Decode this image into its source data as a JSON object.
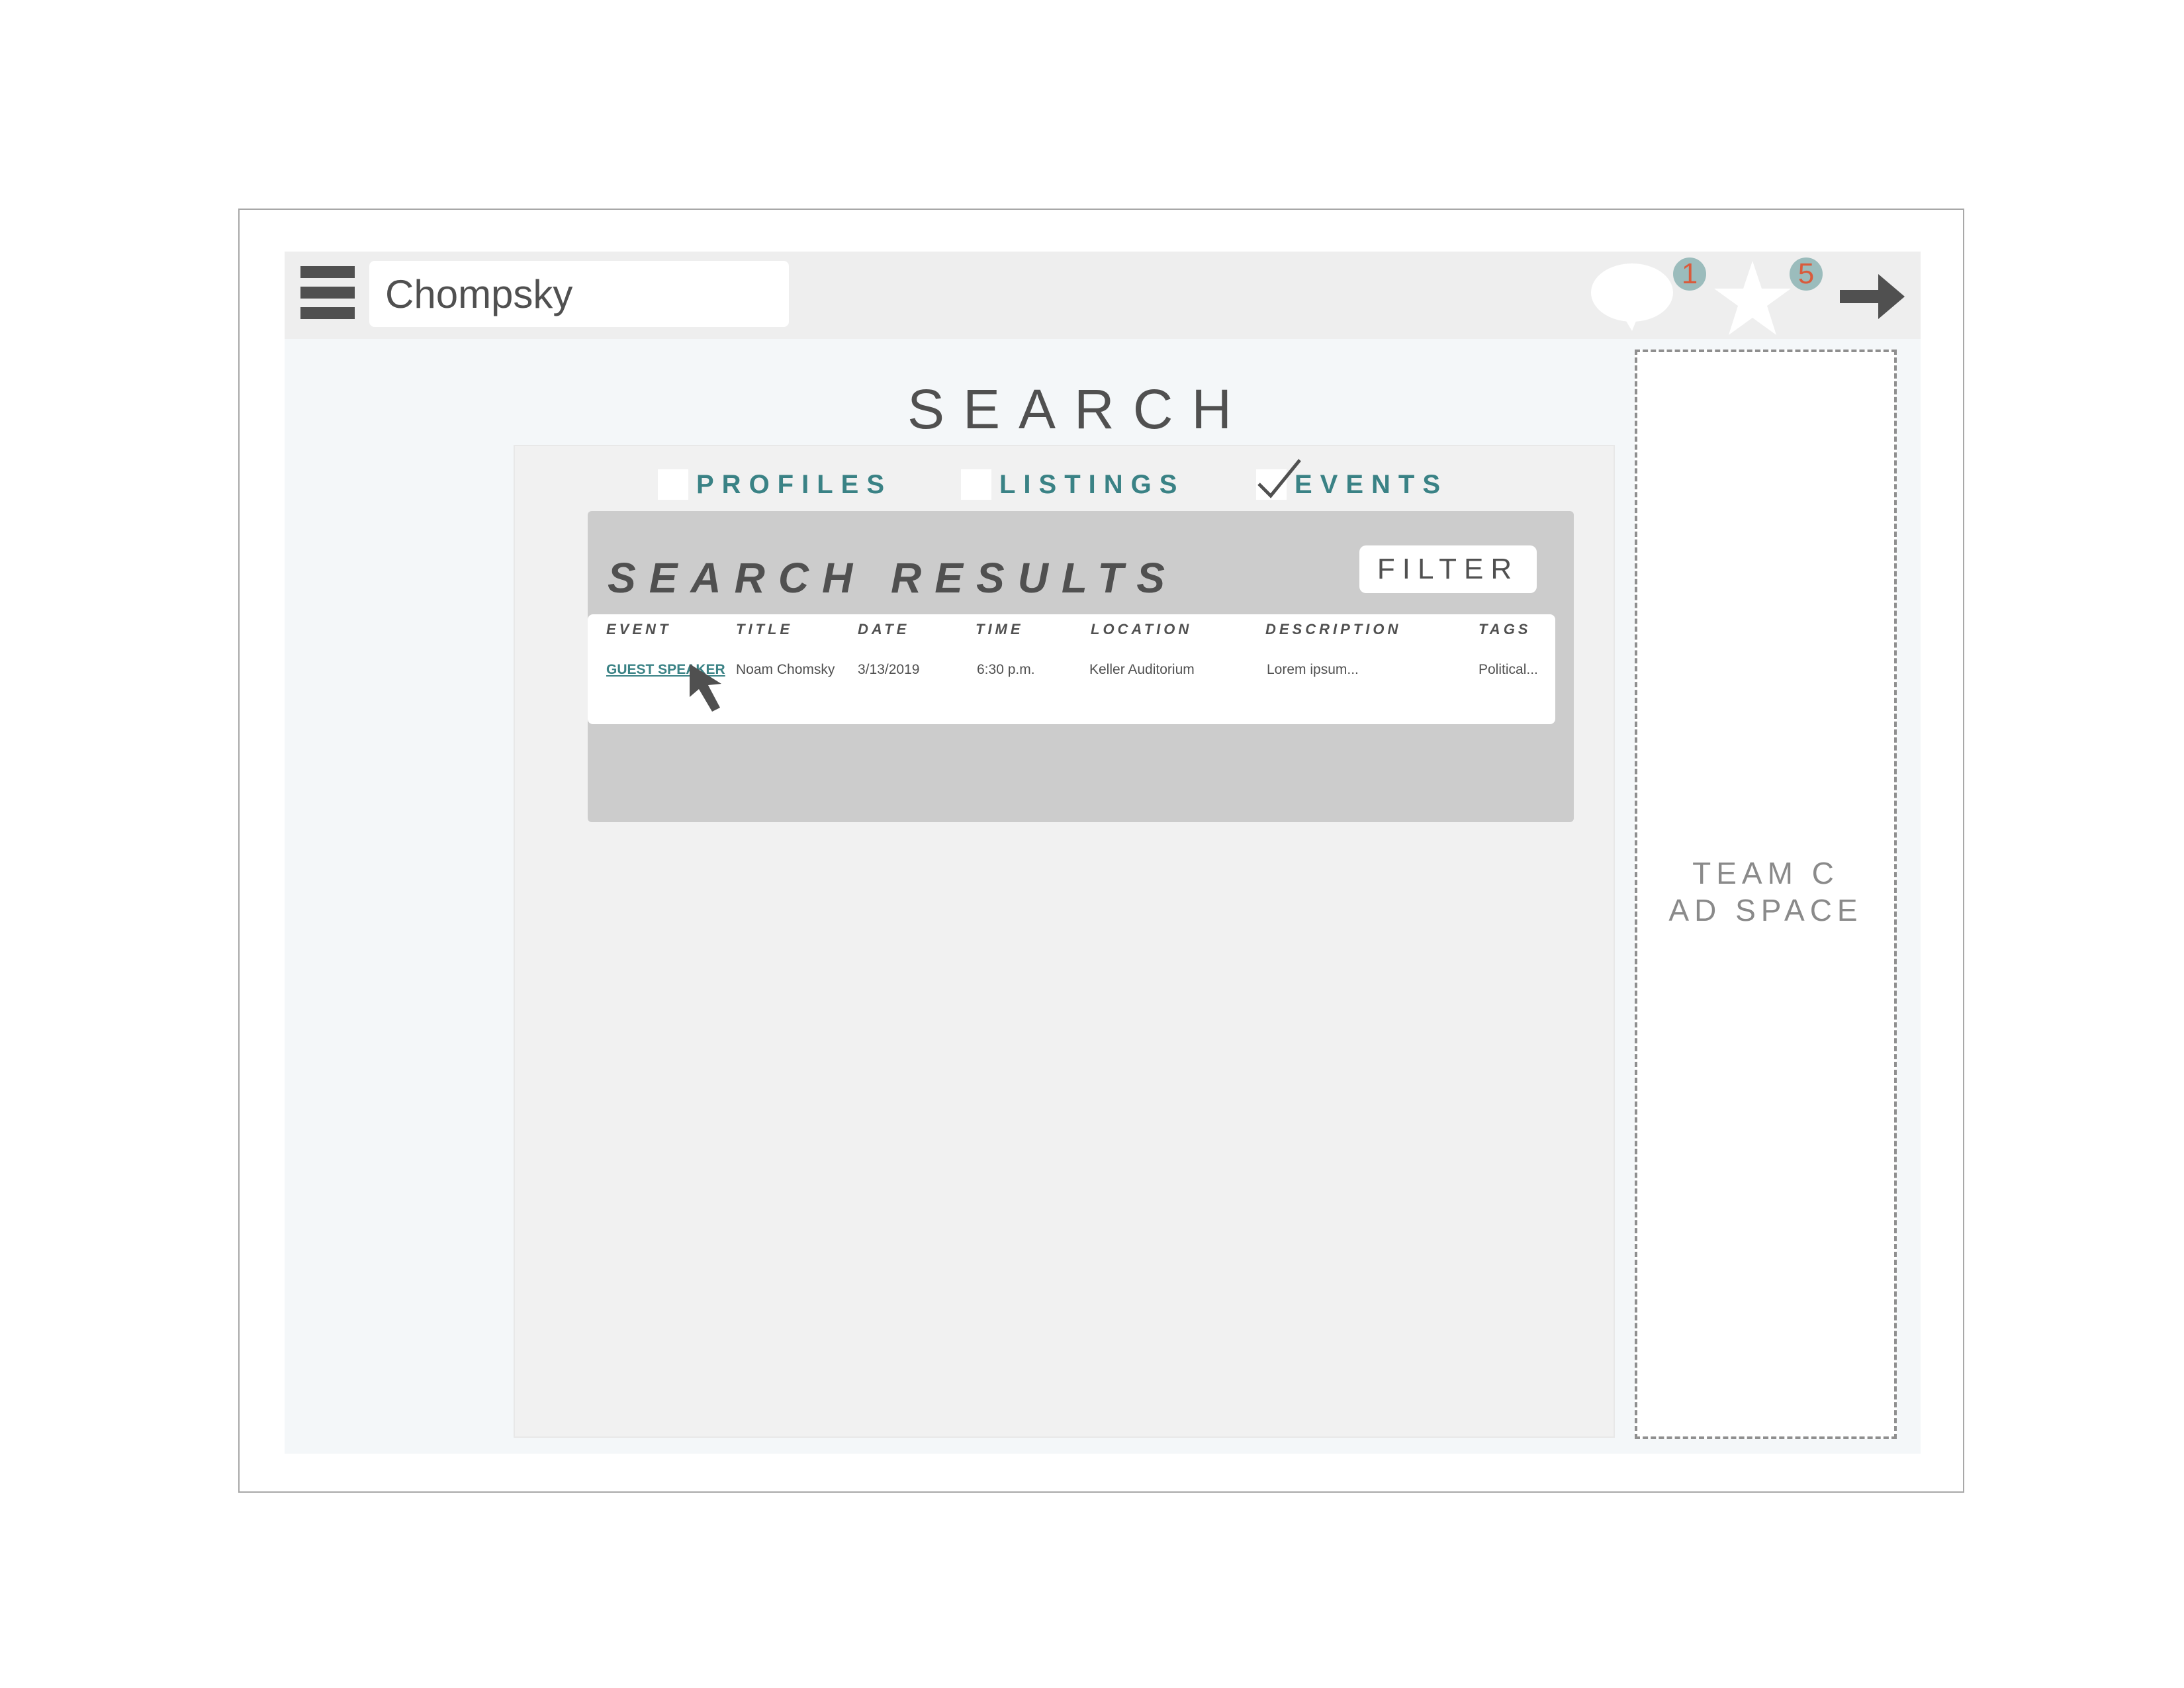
{
  "header": {
    "search_value": "Chompsky",
    "messages_count": "1",
    "favorites_count": "5",
    "icons": {
      "menu": "hamburger-menu-icon",
      "messages": "speech-bubble-icon",
      "favorites": "star-icon",
      "logout": "arrow-right-icon"
    }
  },
  "page": {
    "title": "SEARCH"
  },
  "categories": [
    {
      "label": "PROFILES",
      "checked": false
    },
    {
      "label": "LISTINGS",
      "checked": false
    },
    {
      "label": "EVENTS",
      "checked": true
    }
  ],
  "results": {
    "title": "SEARCH RESULTS",
    "filter_label": "FILTER",
    "columns": [
      "EVENT",
      "TITLE",
      "DATE",
      "TIME",
      "LOCATION",
      "DESCRIPTION",
      "TAGS"
    ],
    "rows": [
      {
        "event": "GUEST SPEAKER",
        "title": "Noam Chomsky",
        "date": "3/13/2019",
        "time": "6:30 p.m.",
        "location": "Keller Auditorium",
        "description": "Lorem ipsum...",
        "tags": "Political..."
      }
    ]
  },
  "ad": {
    "line1": "TEAM C",
    "line2": "AD SPACE"
  },
  "colors": {
    "accent": "#3a8285",
    "badge_bg": "#9bbcbc",
    "badge_text": "#d95b3c",
    "text": "#505050"
  }
}
